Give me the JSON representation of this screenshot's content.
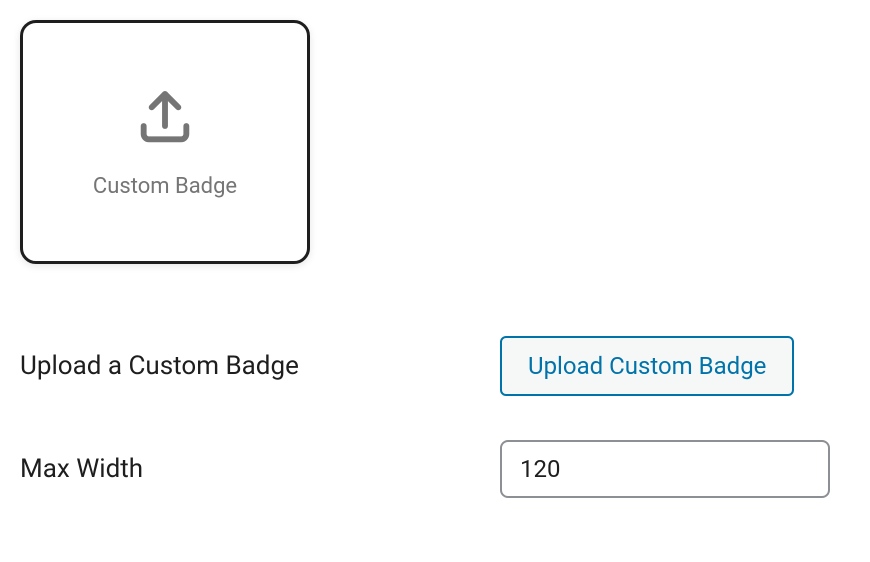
{
  "badge_card": {
    "label": "Custom Badge"
  },
  "settings": {
    "upload_label": "Upload a Custom Badge",
    "upload_button": "Upload Custom Badge",
    "max_width_label": "Max Width",
    "max_width_value": "120"
  }
}
